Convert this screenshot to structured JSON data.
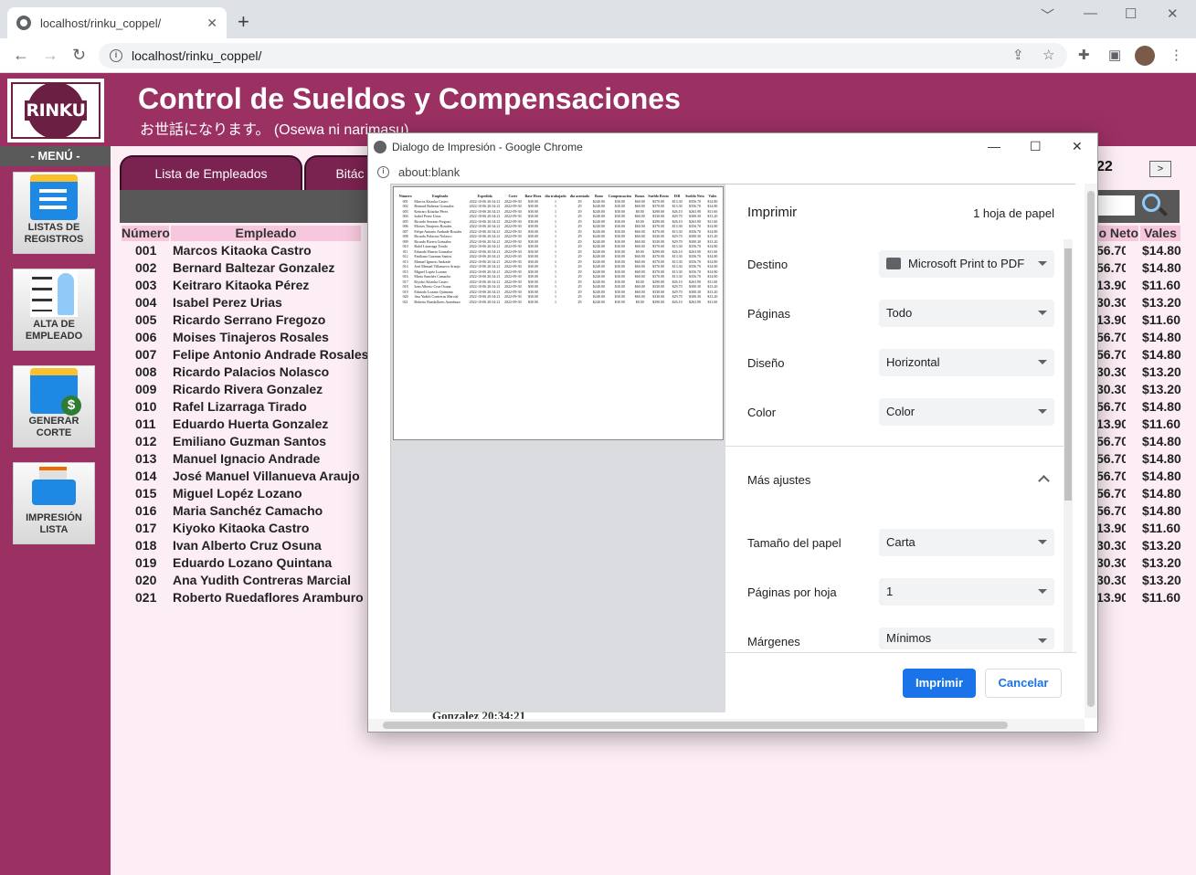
{
  "browser": {
    "tab_title": "localhost/rinku_coppel/",
    "tab_close": "✕",
    "new_tab": "+",
    "url": "localhost/rinku_coppel/",
    "window_controls": [
      "﹀",
      "—",
      "☐",
      "✕"
    ],
    "nav": [
      "←",
      "→",
      "↻"
    ]
  },
  "app": {
    "logo": "RINKU",
    "title": "Control de Sueldos y Compensaciones",
    "subtitle": "お世話になります。 (Osewa ni narimasu)",
    "menu_label": "- MENÚ -",
    "sidebar": [
      {
        "line1": "LISTAS DE",
        "line2": "REGISTROS",
        "icon": "list-icon"
      },
      {
        "line1": "ALTA DE",
        "line2": "EMPLEADO",
        "icon": "checklist-person-icon"
      },
      {
        "line1": "GENERAR",
        "line2": "CORTE",
        "icon": "money-list-icon"
      },
      {
        "line1": "IMPRESIÓN",
        "line2": "LISTA",
        "icon": "printer-icon"
      }
    ],
    "tabs": [
      "Lista de Empleados",
      "Bitác"
    ],
    "year_fragment": "22",
    "next_label": ">",
    "table_headers": {
      "numero": "Número",
      "empleado": "Empleado",
      "neto": "o Neto",
      "vales": "Vales",
      "partial": "Nu"
    },
    "employees": [
      {
        "num": "001",
        "name": "Marcos Kitaoka Castro",
        "neto": "56.70",
        "vales": "$14.80"
      },
      {
        "num": "002",
        "name": "Bernard Baltezar Gonzalez",
        "neto": "56.70",
        "vales": "$14.80"
      },
      {
        "num": "003",
        "name": "Keitraro Kitaoka Pérez",
        "neto": "13.90",
        "vales": "$11.60"
      },
      {
        "num": "004",
        "name": "Isabel Perez Urias",
        "neto": "30.30",
        "vales": "$13.20"
      },
      {
        "num": "005",
        "name": "Ricardo Serrano Fregozo",
        "neto": "13.90",
        "vales": "$11.60"
      },
      {
        "num": "006",
        "name": "Moises Tinajeros Rosales",
        "neto": "56.70",
        "vales": "$14.80"
      },
      {
        "num": "007",
        "name": "Felipe Antonio Andrade Rosales",
        "neto": "56.70",
        "vales": "$14.80"
      },
      {
        "num": "008",
        "name": "Ricardo Palacios Nolasco",
        "neto": "30.30",
        "vales": "$13.20"
      },
      {
        "num": "009",
        "name": "Ricardo Rivera Gonzalez",
        "neto": "30.30",
        "vales": "$13.20"
      },
      {
        "num": "010",
        "name": "Rafel Lizarraga Tirado",
        "neto": "56.70",
        "vales": "$14.80"
      },
      {
        "num": "011",
        "name": "Eduardo Huerta Gonzalez",
        "neto": "13.90",
        "vales": "$11.60"
      },
      {
        "num": "012",
        "name": "Emiliano Guzman Santos",
        "neto": "56.70",
        "vales": "$14.80"
      },
      {
        "num": "013",
        "name": "Manuel Ignacio Andrade",
        "neto": "56.70",
        "vales": "$14.80"
      },
      {
        "num": "014",
        "name": "José Manuel Villanueva Araujo",
        "neto": "56.70",
        "vales": "$14.80"
      },
      {
        "num": "015",
        "name": "Miguel Lopéz Lozano",
        "neto": "56.70",
        "vales": "$14.80"
      },
      {
        "num": "016",
        "name": "Maria Sanchéz Camacho",
        "neto": "56.70",
        "vales": "$14.80"
      },
      {
        "num": "017",
        "name": "Kiyoko Kitaoka Castro",
        "neto": "13.90",
        "vales": "$11.60"
      },
      {
        "num": "018",
        "name": "Ivan Alberto Cruz Osuna",
        "neto": "30.30",
        "vales": "$13.20"
      },
      {
        "num": "019",
        "name": "Eduardo Lozano Quintana",
        "neto": "30.30",
        "vales": "$13.20"
      },
      {
        "num": "020",
        "name": "Ana Yudith Contreras Marcial",
        "neto": "30.30",
        "vales": "$13.20"
      },
      {
        "num": "021",
        "name": "Roberto Ruedaflores Aramburo",
        "neto": "13.90",
        "vales": "$11.60"
      }
    ]
  },
  "dialog": {
    "title": "Dialogo de Impresión - Google Chrome",
    "url": "about:blank",
    "heading": "Imprimir",
    "sheets": "1 hoja de papel",
    "settings": [
      {
        "label": "Destino",
        "value": "Microsoft Print to PDF"
      },
      {
        "label": "Páginas",
        "value": "Todo"
      },
      {
        "label": "Diseño",
        "value": "Horizontal"
      },
      {
        "label": "Color",
        "value": "Color"
      }
    ],
    "more_settings": "Más ajustes",
    "more": [
      {
        "label": "Tamaño del papel",
        "value": "Carta"
      },
      {
        "label": "Páginas por hoja",
        "value": "1"
      },
      {
        "label": "Márgenes",
        "value": "Mínimos"
      }
    ],
    "print_button": "Imprimir",
    "cancel_button": "Cancelar",
    "peek_text": "Gonzalez     20:34:21",
    "preview_headers": [
      "Número",
      "Empleado",
      "Expedida",
      "Corte",
      "Base Hora",
      "día trabajado",
      "día asentado",
      "Bono",
      "Compensación",
      "Bonos",
      "Sueldo Bruto",
      "ISR",
      "Sueldo Neto",
      "Vales"
    ],
    "preview_rows": [
      [
        "001",
        "Marcos Kitaoka Castro",
        "2022-10-06 20:34:21",
        "2022-09-30",
        "$30.00",
        "1",
        "29",
        "$240.00",
        "$30.00",
        "$60.00",
        "$370.00",
        "$13.30",
        "$356.70",
        "$14.80"
      ],
      [
        "002",
        "Bernard Baltezar Gonzalez",
        "2022-10-06 20:34:21",
        "2022-09-30",
        "$30.00",
        "1",
        "29",
        "$240.00",
        "$30.00",
        "$60.00",
        "$370.00",
        "$13.30",
        "$356.70",
        "$14.80"
      ],
      [
        "003",
        "Keitraro Kitaoka Pérez",
        "2022-10-06 20:34:21",
        "2022-09-30",
        "$30.00",
        "1",
        "29",
        "$240.00",
        "$30.00",
        "$0.00",
        "$290.00",
        "$26.10",
        "$263.90",
        "$11.60"
      ],
      [
        "004",
        "Isabel Perez Urias",
        "2022-10-06 20:34:21",
        "2022-09-30",
        "$30.00",
        "1",
        "29",
        "$240.00",
        "$30.00",
        "$60.00",
        "$330.00",
        "$29.70",
        "$300.30",
        "$13.20"
      ],
      [
        "005",
        "Ricardo Serrano Fregozo",
        "2022-10-06 20:34:21",
        "2022-09-30",
        "$30.00",
        "1",
        "29",
        "$240.00",
        "$30.00",
        "$0.00",
        "$290.00",
        "$26.10",
        "$263.90",
        "$11.60"
      ],
      [
        "006",
        "Moises Tinajeros Rosales",
        "2022-10-06 20:34:21",
        "2022-09-30",
        "$30.00",
        "1",
        "29",
        "$240.00",
        "$30.00",
        "$60.00",
        "$370.00",
        "$13.30",
        "$356.70",
        "$14.80"
      ],
      [
        "007",
        "Felipe Antonio Andrade Rosales",
        "2022-10-06 20:34:21",
        "2022-09-30",
        "$30.00",
        "1",
        "29",
        "$240.00",
        "$30.00",
        "$60.00",
        "$370.00",
        "$13.30",
        "$356.70",
        "$14.80"
      ],
      [
        "008",
        "Ricardo Palacios Nolasco",
        "2022-10-06 20:34:21",
        "2022-09-30",
        "$30.00",
        "1",
        "29",
        "$240.00",
        "$30.00",
        "$60.00",
        "$330.00",
        "$29.70",
        "$300.30",
        "$13.20"
      ],
      [
        "009",
        "Ricardo Rivera Gonzalez",
        "2022-10-06 20:34:21",
        "2022-09-30",
        "$30.00",
        "1",
        "29",
        "$240.00",
        "$30.00",
        "$60.00",
        "$330.00",
        "$29.70",
        "$300.30",
        "$13.20"
      ],
      [
        "010",
        "Rafel Lizarraga Tirado",
        "2022-10-06 20:34:21",
        "2022-09-30",
        "$30.00",
        "1",
        "29",
        "$240.00",
        "$30.00",
        "$60.00",
        "$370.00",
        "$13.30",
        "$356.70",
        "$14.80"
      ],
      [
        "011",
        "Eduardo Huerta Gonzalez",
        "2022-10-06 20:34:21",
        "2022-09-30",
        "$30.00",
        "1",
        "29",
        "$240.00",
        "$30.00",
        "$0.00",
        "$290.00",
        "$26.10",
        "$263.90",
        "$11.60"
      ],
      [
        "012",
        "Emiliano Guzman Santos",
        "2022-10-06 20:34:21",
        "2022-09-30",
        "$30.00",
        "1",
        "29",
        "$240.00",
        "$30.00",
        "$60.00",
        "$370.00",
        "$13.30",
        "$356.70",
        "$14.80"
      ],
      [
        "013",
        "Manuel Ignacio Andrade",
        "2022-10-06 20:34:21",
        "2022-09-30",
        "$30.00",
        "1",
        "29",
        "$240.00",
        "$30.00",
        "$60.00",
        "$370.00",
        "$13.30",
        "$356.70",
        "$14.80"
      ],
      [
        "014",
        "José Manuel Villanueva Araujo",
        "2022-10-06 20:34:21",
        "2022-09-30",
        "$30.00",
        "1",
        "29",
        "$240.00",
        "$30.00",
        "$60.00",
        "$370.00",
        "$13.30",
        "$356.70",
        "$14.80"
      ],
      [
        "015",
        "Miguel Lopéz Lozano",
        "2022-10-06 20:34:21",
        "2022-09-30",
        "$30.00",
        "1",
        "29",
        "$240.00",
        "$30.00",
        "$60.00",
        "$370.00",
        "$13.30",
        "$356.70",
        "$14.80"
      ],
      [
        "016",
        "Maria Sanchéz Camacho",
        "2022-10-06 20:34:21",
        "2022-09-30",
        "$30.00",
        "1",
        "29",
        "$240.00",
        "$30.00",
        "$60.00",
        "$370.00",
        "$13.30",
        "$356.70",
        "$14.80"
      ],
      [
        "017",
        "Kiyoko Kitaoka Castro",
        "2022-10-06 20:34:21",
        "2022-09-30",
        "$30.00",
        "1",
        "29",
        "$240.00",
        "$30.00",
        "$0.00",
        "$290.00",
        "$26.10",
        "$263.90",
        "$11.60"
      ],
      [
        "018",
        "Ivan Alberto Cruz Osuna",
        "2022-10-06 20:34:21",
        "2022-09-30",
        "$30.00",
        "1",
        "29",
        "$240.00",
        "$30.00",
        "$60.00",
        "$330.00",
        "$29.70",
        "$300.30",
        "$13.20"
      ],
      [
        "019",
        "Eduardo Lozano Quintana",
        "2022-10-06 20:34:21",
        "2022-09-30",
        "$30.00",
        "1",
        "29",
        "$240.00",
        "$30.00",
        "$60.00",
        "$330.00",
        "$29.70",
        "$300.30",
        "$13.20"
      ],
      [
        "020",
        "Ana Yudith Contreras Marcial",
        "2022-10-06 20:34:21",
        "2022-09-30",
        "$30.00",
        "1",
        "29",
        "$240.00",
        "$30.00",
        "$60.00",
        "$330.00",
        "$29.70",
        "$300.30",
        "$13.20"
      ],
      [
        "021",
        "Roberto Ruedaflores Aramburo",
        "2022-10-06 20:34:21",
        "2022-09-30",
        "$30.00",
        "1",
        "29",
        "$240.00",
        "$30.00",
        "$0.00",
        "$290.00",
        "$26.10",
        "$263.90",
        "$11.60"
      ]
    ]
  }
}
